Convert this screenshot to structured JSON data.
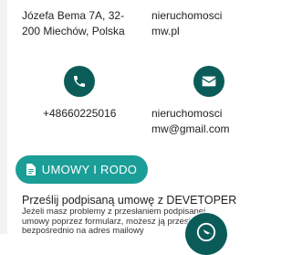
{
  "contact": {
    "address_line1": "Józefa Bema 7A, 32-",
    "address_line2": "200 Miechów, Polska",
    "web_domain": "nieruchomoscimw.pl",
    "phone": "+48660225016",
    "email": "nieruchomoscimw@gmail.com"
  },
  "icons": {
    "phone": "phone-icon",
    "mail": "envelope-icon",
    "file": "file-icon",
    "chat": "chat-icon"
  },
  "button": {
    "contract_label": "UMOWY I RODO"
  },
  "section": {
    "title": "Prześlij podpisaną umowę z DEVETOPER",
    "body": "Jeżeli masz problemy z przesłaniem podpisanej umowy poprzez formularz, możesz ją przesłać bezpośrednio na adres mailowy"
  },
  "colors": {
    "accent_dark": "#0b5c59",
    "accent_button": "#1b9e97"
  }
}
